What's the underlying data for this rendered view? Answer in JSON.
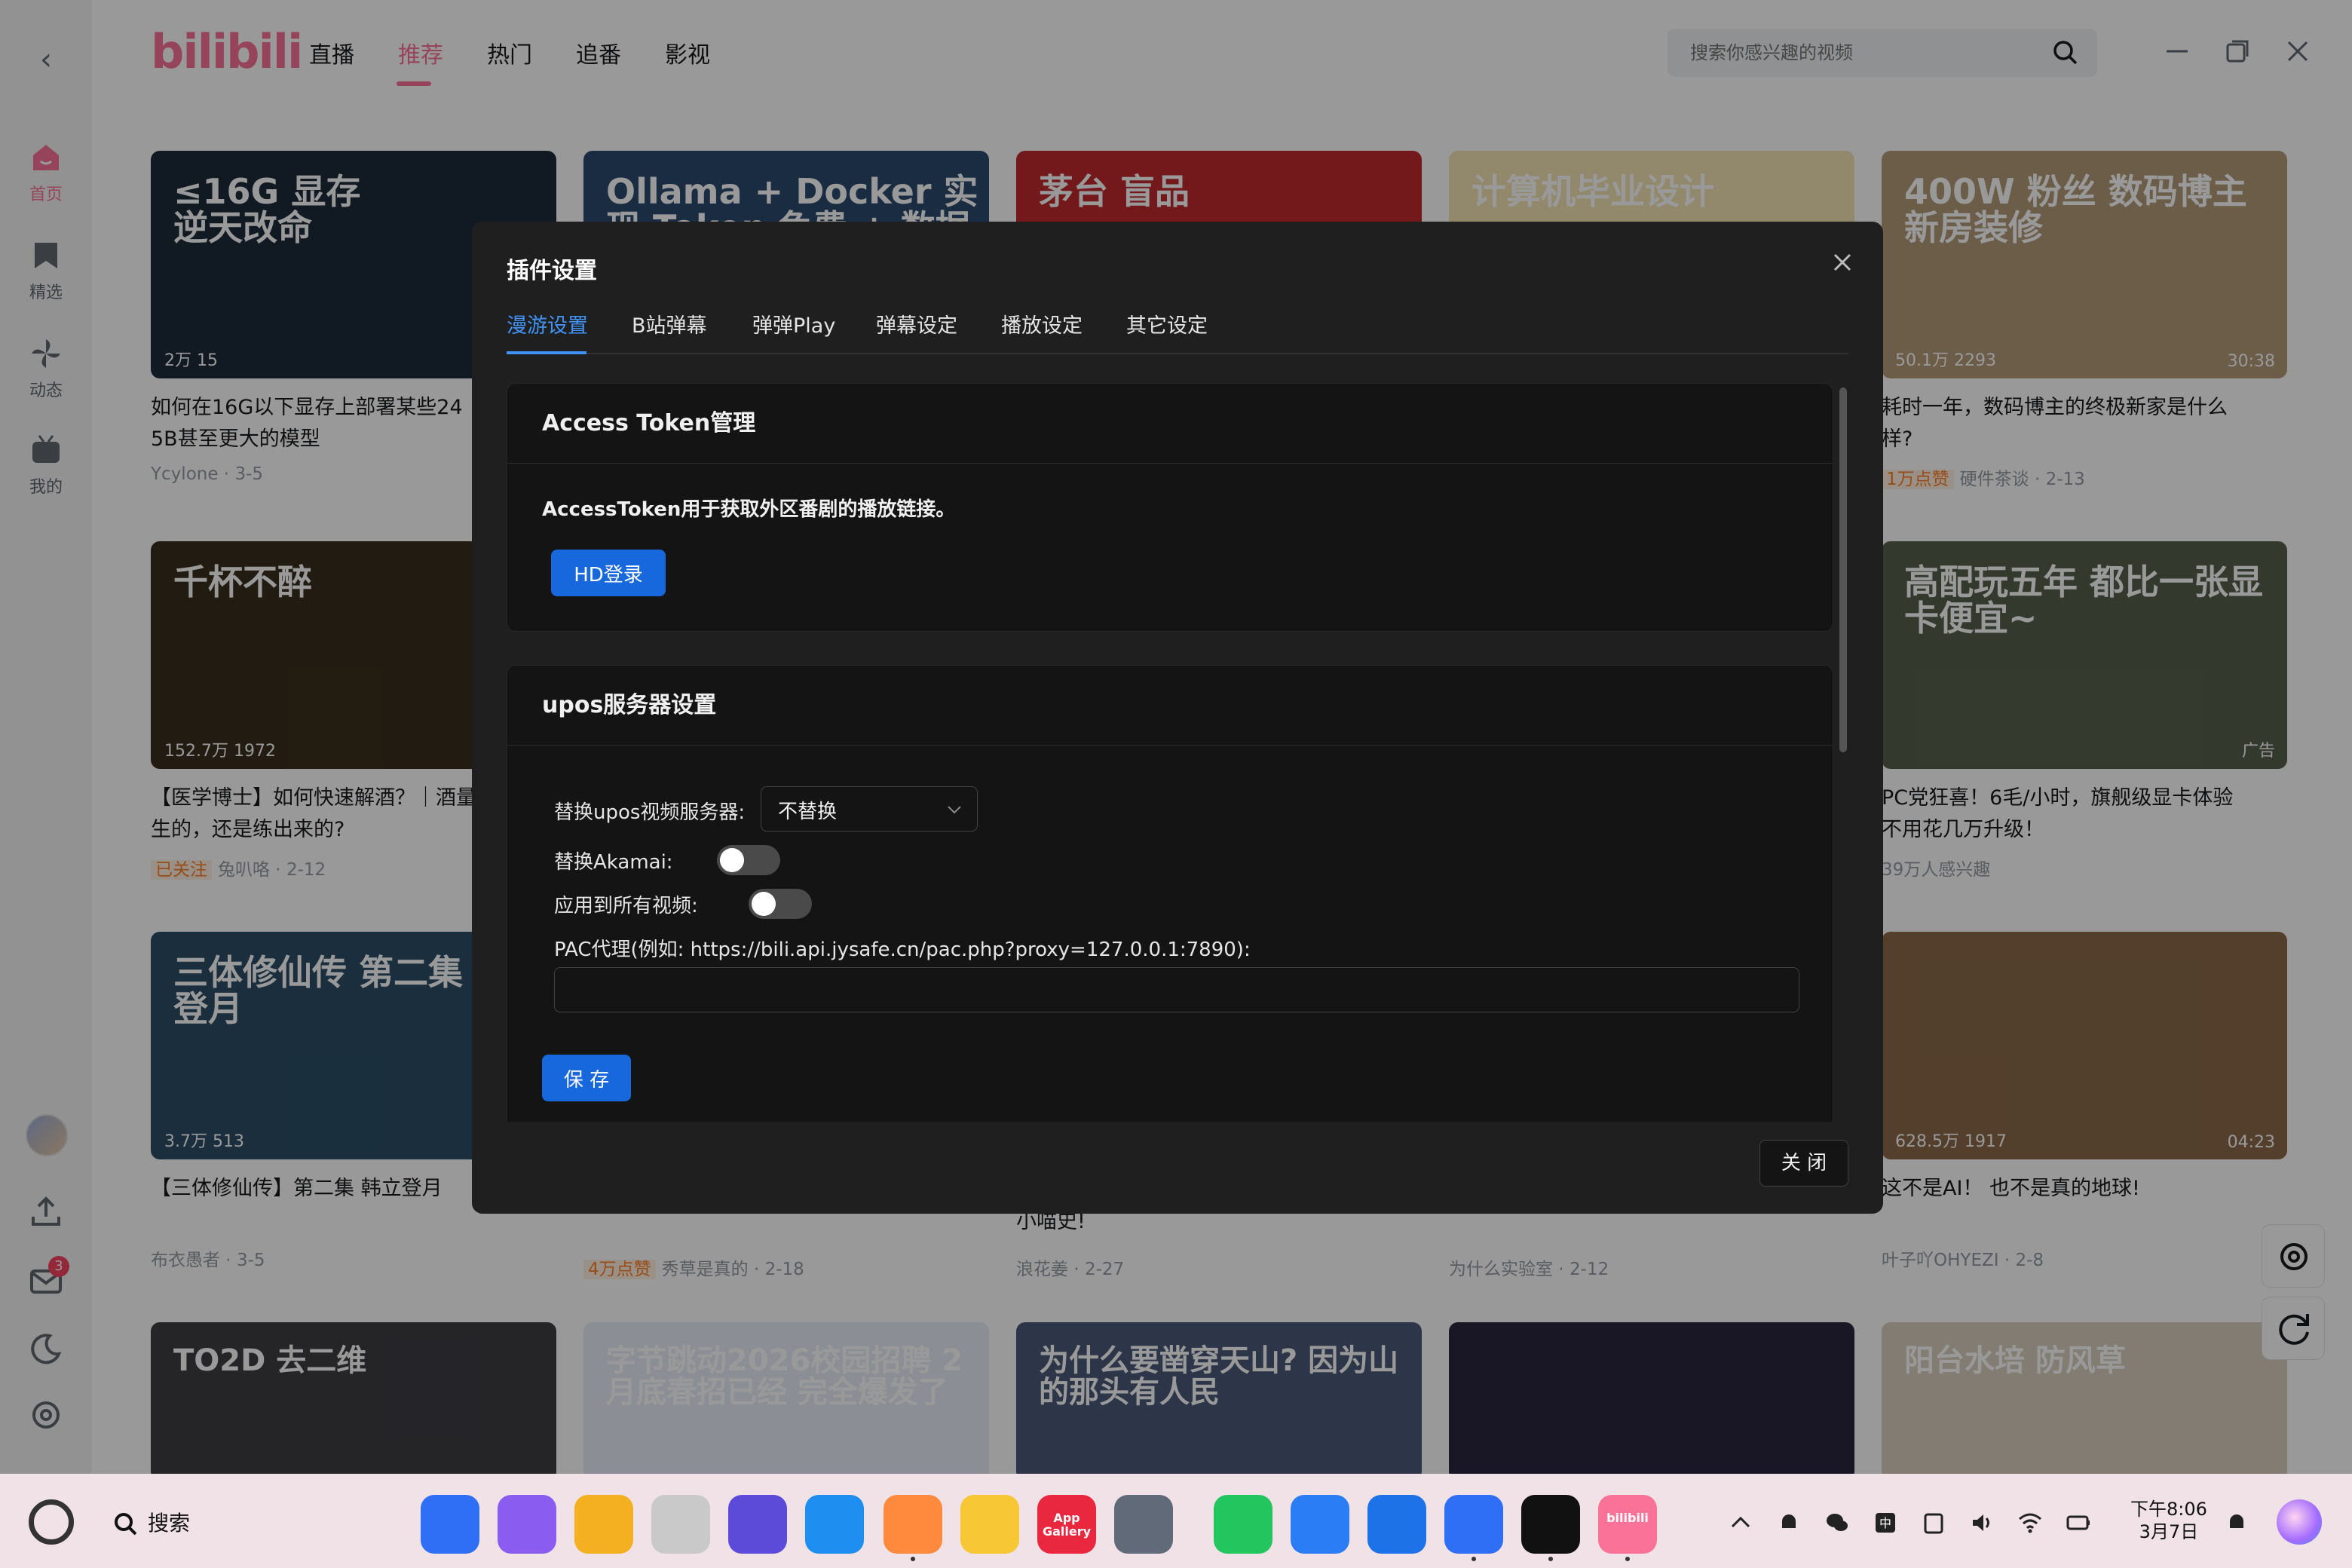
{
  "header": {
    "logo_text": "bilibili",
    "nav": [
      "直播",
      "推荐",
      "热门",
      "追番",
      "影视"
    ],
    "active_nav": "推荐",
    "search_placeholder": "搜索你感兴趣的视频"
  },
  "sidebar": {
    "items": [
      {
        "label": "首页",
        "icon": "home-icon",
        "active": true
      },
      {
        "label": "精选",
        "icon": "bookmark-icon"
      },
      {
        "label": "动态",
        "icon": "pinwheel-icon"
      },
      {
        "label": "我的",
        "icon": "tv-icon"
      }
    ],
    "message_badge": "3"
  },
  "videos": [
    {
      "overlay": "≤16G 显存\n逆天改命",
      "plays": "2万",
      "danmaku": "15",
      "title": "如何在16G以下显存上部署某些24",
      "title2": "5B甚至更大的模型",
      "author": "Ycylone",
      "date": "3-5",
      "tag": "",
      "bg": "#1d2b3a",
      "dur": ""
    },
    {
      "overlay": "Ollama + Docker 实现 Token 免费 + 数据隐私",
      "plays": "",
      "danmaku": "",
      "title": "",
      "title2": "",
      "author": "",
      "date": "",
      "tag": "",
      "bg": "#2a4a6e",
      "dur": ""
    },
    {
      "overlay": "茅台 盲品",
      "plays": "",
      "danmaku": "",
      "title": "",
      "title2": "",
      "author": "",
      "date": "",
      "tag": "",
      "bg": "#c0282d",
      "dur": ""
    },
    {
      "overlay": "计算机毕业设计",
      "plays": "",
      "danmaku": "",
      "title": "",
      "title2": "",
      "author": "",
      "date": "",
      "tag": "",
      "bg": "#f3e3b2",
      "dur": ""
    },
    {
      "overlay": "400W 粉丝 数码博主 新房装修",
      "plays": "50.1万",
      "danmaku": "2293",
      "title": "耗时一年，数码博主的终极新家是什么",
      "title2": "样?",
      "author": "硬件茶谈",
      "date": "2-13",
      "tag": "1万点赞",
      "bg": "#b59c7a",
      "dur": "30:38"
    },
    {
      "overlay": "千杯不醉",
      "plays": "152.7万",
      "danmaku": "1972",
      "title": "【医学博士】如何快速解酒？｜酒量",
      "title2": "生的，还是练出来的?",
      "author": "兔叭咯",
      "date": "2-12",
      "tag": "已关注",
      "bg": "#3a2e1d",
      "dur": ""
    },
    {
      "overlay": "高配玩五年 都比一张显卡便宜~",
      "plays": "",
      "danmaku": "",
      "title": "PC党狂喜！6毛/小时，旗舰级显卡体验",
      "title2": "不用花几万升级！",
      "author": "39万人感兴趣",
      "date": "",
      "tag": "",
      "bg": "#58604c",
      "dur": "广告"
    },
    {
      "overlay": "三体修仙传 第二集 韩立登月",
      "plays": "3.7万",
      "danmaku": "513",
      "title": "【三体修仙传】第二集 韩立登月",
      "title2": "",
      "author": "布衣愚者",
      "date": "3-5",
      "tag": "",
      "bg": "#2c4e66",
      "dur": ""
    },
    {
      "overlay": "",
      "plays": "628.5万",
      "danmaku": "1917",
      "title": "这不是AI！ 也不是真的地球!",
      "title2": "",
      "author": "叶子吖OHYEZI",
      "date": "2-8",
      "tag": "",
      "bg": "#8a6a4a",
      "dur": "04:23"
    }
  ],
  "row3_meta": [
    {
      "author": "秀草是真的",
      "date": "2-18",
      "tag": "4万点赞"
    },
    {
      "author": "浪花姜",
      "date": "2-27",
      "tag": "",
      "title": "小喵史!"
    },
    {
      "author": "为什么实验室",
      "date": "2-12",
      "tag": ""
    }
  ],
  "row4": [
    {
      "overlay": "TO2D 去二维",
      "bg": "#3e3e44"
    },
    {
      "overlay": "字节跳动2026校园招聘 2月底春招已经 完全爆发了",
      "bg": "#e8eef8"
    },
    {
      "overlay": "为什么要凿穿天山? 因为山的那头有人民",
      "bg": "#4a5a78"
    },
    {
      "overlay": "",
      "bg": "#2a2640"
    },
    {
      "overlay": "阳台水培 防风草",
      "bg": "#d9cfc0"
    }
  ],
  "modal": {
    "title": "插件设置",
    "tabs": [
      "漫游设置",
      "B站弹幕",
      "弹弹Play",
      "弹幕设定",
      "播放设定",
      "其它设定"
    ],
    "active_tab": "漫游设置",
    "section1": {
      "title": "Access Token管理",
      "desc": "AccessToken用于获取外区番剧的播放链接。",
      "button": "HD登录"
    },
    "section2": {
      "title": "upos服务器设置",
      "replace_label": "替换upos视频服务器:",
      "replace_value": "不替换",
      "akamai_label": "替换Akamai:",
      "akamai_on": false,
      "apply_all_label": "应用到所有视频:",
      "apply_all_on": false,
      "pac_label": "PAC代理(例如: https://bili.api.jysafe.cn/pac.php?proxy=127.0.0.1:7890):",
      "pac_value": "",
      "save_button": "保 存"
    },
    "close_button": "关 闭"
  },
  "taskbar": {
    "search_label": "搜索",
    "time": "下午8:06",
    "date": "3月7日",
    "apps": [
      {
        "name": "app-launcher",
        "color": "#2f6ff5"
      },
      {
        "name": "multitask",
        "color": "#8a5cf0"
      },
      {
        "name": "files",
        "color": "#f5b021"
      },
      {
        "name": "trash",
        "color": "#c9c9c9"
      },
      {
        "name": "xiaoyi",
        "color": "#5b4bd8"
      },
      {
        "name": "browser",
        "color": "#1e8ff0"
      },
      {
        "name": "gallery",
        "color": "#ff8a3d"
      },
      {
        "name": "notes",
        "color": "#f7c735"
      },
      {
        "name": "app-gallery",
        "color": "#e9273f",
        "text": "App Gallery"
      },
      {
        "name": "settings",
        "color": "#606a78"
      },
      {
        "name": "phone",
        "color": "#22c55e"
      },
      {
        "name": "messages",
        "color": "#2b7df5"
      },
      {
        "name": "mail",
        "color": "#1d72e8"
      },
      {
        "name": "tools",
        "color": "#2f6ff5"
      },
      {
        "name": "qq",
        "color": "#111111"
      },
      {
        "name": "bilibili",
        "color": "#fb7299",
        "text": "bilibili"
      }
    ]
  }
}
